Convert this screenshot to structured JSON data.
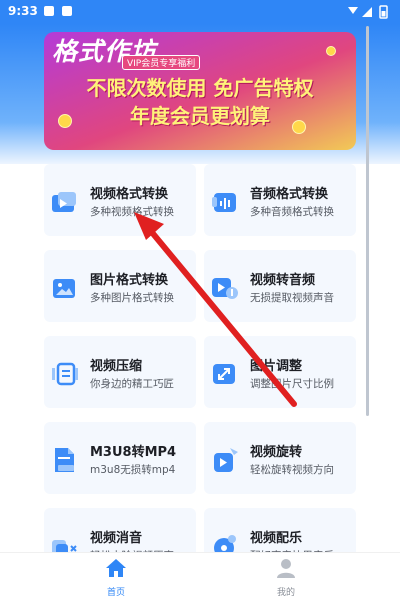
{
  "status_bar": {
    "time": "9:33"
  },
  "banner": {
    "logo": "格式作坊",
    "vip_tag": "VIP会员专享福利",
    "line1": "不限次数使用 免广告特权",
    "line2": "年度会员更划算"
  },
  "tools": [
    {
      "title": "视频格式转换",
      "subtitle": "多种视频格式转换",
      "icon": "video-play-icon"
    },
    {
      "title": "音频格式转换",
      "subtitle": "多种音频格式转换",
      "icon": "audio-wave-icon"
    },
    {
      "title": "图片格式转换",
      "subtitle": "多种图片格式转换",
      "icon": "image-icon"
    },
    {
      "title": "视频转音频",
      "subtitle": "无损提取视频声音",
      "icon": "video-to-audio-icon"
    },
    {
      "title": "视频压缩",
      "subtitle": "你身边的精工巧匠",
      "icon": "compress-icon"
    },
    {
      "title": "图片调整",
      "subtitle": "调整图片尺寸比例",
      "icon": "image-resize-icon"
    },
    {
      "title": "M3U8转MP4",
      "subtitle": "m3u8无损转mp4",
      "icon": "file-mp4-icon"
    },
    {
      "title": "视频旋转",
      "subtitle": "轻松旋转视频方向",
      "icon": "rotate-video-icon"
    },
    {
      "title": "视频消音",
      "subtitle": "轻松去除视频原声",
      "icon": "mute-video-icon"
    },
    {
      "title": "视频配乐",
      "subtitle": "配好声音快思音乐",
      "icon": "music-video-icon"
    }
  ],
  "tabbar": {
    "home": {
      "label": "首页",
      "icon": "home-icon"
    },
    "me": {
      "label": "我的",
      "icon": "user-icon"
    }
  },
  "colors": {
    "accent": "#2f86f6",
    "card_bg": "#f4f8fe",
    "annotation_arrow": "#e02020"
  }
}
